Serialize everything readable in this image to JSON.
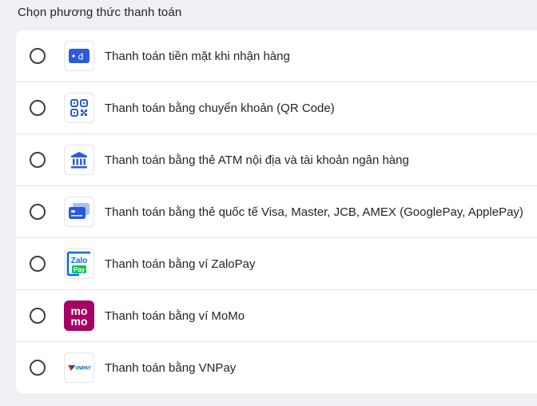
{
  "header": {
    "title": "Chọn phương thức thanh toán"
  },
  "payment_methods": [
    {
      "label": "Thanh toán tiền mặt khi nhận hàng",
      "icon": "cash-icon",
      "selected": false
    },
    {
      "label": "Thanh toán bằng chuyển khoản (QR Code)",
      "icon": "qr-code-icon",
      "selected": false
    },
    {
      "label": "Thanh toán bằng thẻ ATM nội địa và tài khoản ngân hàng",
      "icon": "bank-icon",
      "selected": false
    },
    {
      "label": "Thanh toán bằng thẻ quốc tế Visa, Master, JCB, AMEX (GooglePay, ApplePay)",
      "icon": "credit-card-icon",
      "selected": false
    },
    {
      "label": "Thanh toán bằng ví ZaloPay",
      "icon": "zalopay-logo",
      "logo_text": [
        "Zalo",
        "Pay"
      ],
      "selected": false
    },
    {
      "label": "Thanh toán bằng ví MoMo",
      "icon": "momo-logo",
      "logo_text": [
        "mo",
        "mo"
      ],
      "selected": false
    },
    {
      "label": "Thanh toán bằng VNPay",
      "icon": "vnpay-logo",
      "logo_text": "VNPAY",
      "selected": false
    }
  ],
  "colors": {
    "accent_blue": "#2c5bd8",
    "zalo_blue": "#0068ff",
    "zalo_green": "#00c853",
    "momo": "#a50064",
    "vnpay_red": "#e31e24",
    "vnpay_blue": "#005baa"
  }
}
